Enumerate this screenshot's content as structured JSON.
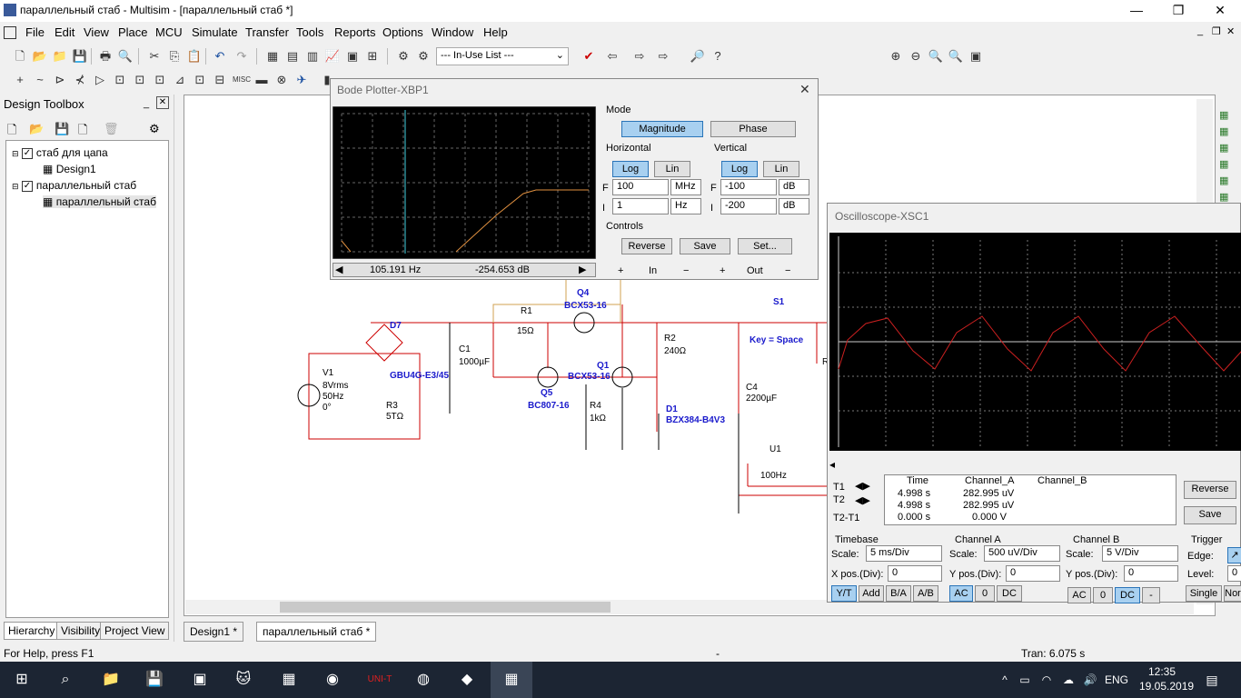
{
  "window": {
    "title": "параллельный стаб - Multisim - [параллельный стаб *]"
  },
  "menu": [
    "File",
    "Edit",
    "View",
    "Place",
    "MCU",
    "Simulate",
    "Transfer",
    "Tools",
    "Reports",
    "Options",
    "Window",
    "Help"
  ],
  "toolbar": {
    "inuse_label": "--- In-Use List ---"
  },
  "toolbox": {
    "title": "Design Toolbox",
    "tree": [
      {
        "label": "стаб для цапа",
        "level": 0
      },
      {
        "label": "Design1",
        "level": 1
      },
      {
        "label": "параллельный стаб",
        "level": 0
      },
      {
        "label": "параллельный стаб",
        "level": 1
      }
    ],
    "tabs": [
      "Hierarchy",
      "Visibility",
      "Project View"
    ]
  },
  "doc_tabs": [
    "Design1 *",
    "параллельный стаб *"
  ],
  "circuit": {
    "labels": {
      "q4": "Q4",
      "q4p": "BCX53-16",
      "r1": "R1",
      "r1v": "15Ω",
      "d7": "D7",
      "c1": "C1",
      "c1v": "1000µF",
      "v1": "V1",
      "v1a": "8Vrms",
      "v1b": "50Hz",
      "v1c": "0°",
      "gbu": "GBU4G-E3/45",
      "r3": "R3",
      "r3v": "5TΩ",
      "q5": "Q5",
      "q5p": "BC807-16",
      "q1": "Q1",
      "q1p": "BCX53-16",
      "r4": "R4",
      "r4v": "1kΩ",
      "r2": "R2",
      "r2v": "240Ω",
      "d1": "D1",
      "d1p": "BZX384-B4V3",
      "c4": "C4",
      "c4v": "2200µF",
      "s1": "S1",
      "key": "Key = Space",
      "u1": "U1",
      "u1v": "100Hz",
      "r5": "R"
    }
  },
  "bode": {
    "title": "Bode Plotter-XBP1",
    "mode_label": "Mode",
    "magnitude": "Magnitude",
    "phase": "Phase",
    "horizontal": "Horizontal",
    "vertical": "Vertical",
    "log": "Log",
    "lin": "Lin",
    "h_f": "100",
    "h_f_unit": "MHz",
    "h_i": "1",
    "h_i_unit": "Hz",
    "v_f": "-100",
    "v_f_unit": "dB",
    "v_i": "-200",
    "v_i_unit": "dB",
    "f_label": "F",
    "i_label": "I",
    "controls": "Controls",
    "reverse": "Reverse",
    "save": "Save",
    "set": "Set...",
    "readout_freq": "105.191 Hz",
    "readout_db": "-254.653 dB",
    "in_label": "In",
    "out_label": "Out",
    "plus": "+",
    "minus": "−"
  },
  "scope": {
    "title": "Oscilloscope-XSC1",
    "t1": "T1",
    "t2": "T2",
    "t21": "T2-T1",
    "col_time": "Time",
    "col_a": "Channel_A",
    "col_b": "Channel_B",
    "rows": [
      {
        "time": "4.998 s",
        "a": "282.995 uV",
        "b": ""
      },
      {
        "time": "4.998 s",
        "a": "282.995 uV",
        "b": ""
      },
      {
        "time": "0.000 s",
        "a": "0.000 V",
        "b": ""
      }
    ],
    "reverse": "Reverse",
    "save": "Save",
    "timebase": "Timebase",
    "scale_label": "Scale:",
    "tb_scale": "5 ms/Div",
    "xpos_label": "X pos.(Div):",
    "xpos": "0",
    "cha": "Channel A",
    "cha_scale": "500 uV/Div",
    "ypos_label": "Y pos.(Div):",
    "cha_ypos": "0",
    "chb": "Channel B",
    "chb_scale": "5  V/Div",
    "chb_ypos": "0",
    "trigger": "Trigger",
    "edge_label": "Edge:",
    "level_label": "Level:",
    "level": "0",
    "yt": "Y/T",
    "add": "Add",
    "ba": "B/A",
    "ab": "A/B",
    "ac": "AC",
    "zero": "0",
    "dc": "DC",
    "minus": "-",
    "single": "Single",
    "nor": "Nor"
  },
  "status": {
    "help": "For Help, press F1",
    "dash": "-",
    "tran": "Tran: 6.075 s"
  },
  "taskbar": {
    "lang": "ENG",
    "time": "12:35",
    "date": "19.05.2019"
  }
}
